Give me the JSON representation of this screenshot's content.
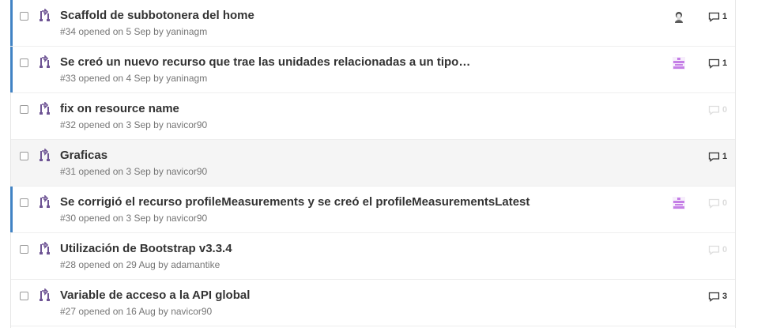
{
  "issues": [
    {
      "title": "Scaffold de subbotonera del home",
      "number": "#34",
      "opened_label": "opened on",
      "date": "5 Sep",
      "by_label": "by",
      "author": "yaninagm",
      "comments": "1",
      "avatar": "person-avatar",
      "unread": true
    },
    {
      "title": "Se creó un nuevo recurso que trae las unidades relacionadas a un tipo…",
      "number": "#33",
      "opened_label": "opened on",
      "date": "4 Sep",
      "by_label": "by",
      "author": "yaninagm",
      "comments": "1",
      "avatar": "identicon-purple",
      "unread": true
    },
    {
      "title": "fix on resource name",
      "number": "#32",
      "opened_label": "opened on",
      "date": "3 Sep",
      "by_label": "by",
      "author": "navicor90",
      "comments": "0",
      "avatar": null,
      "unread": false
    },
    {
      "title": "Graficas",
      "number": "#31",
      "opened_label": "opened on",
      "date": "3 Sep",
      "by_label": "by",
      "author": "navicor90",
      "comments": "1",
      "avatar": null,
      "unread": false,
      "hovered": true
    },
    {
      "title": "Se corrigió el recurso profileMeasurements y se creó el profileMeasurementsLatest",
      "number": "#30",
      "opened_label": "opened on",
      "date": "3 Sep",
      "by_label": "by",
      "author": "navicor90",
      "comments": "0",
      "avatar": "identicon-purple",
      "unread": true
    },
    {
      "title": "Utilización de Bootstrap v3.3.4",
      "number": "#28",
      "opened_label": "opened on",
      "date": "29 Aug",
      "by_label": "by",
      "author": "adamantike",
      "comments": "0",
      "avatar": null,
      "unread": false
    },
    {
      "title": "Variable de acceso a la API global",
      "number": "#27",
      "opened_label": "opened on",
      "date": "16 Aug",
      "by_label": "by",
      "author": "navicor90",
      "comments": "3",
      "avatar": null,
      "unread": false
    }
  ],
  "colors": {
    "unread_bar": "#4183c4",
    "pr_icon": "#6e5494",
    "identicon": "#c57fe6",
    "muted_comment": "#dddddd"
  }
}
